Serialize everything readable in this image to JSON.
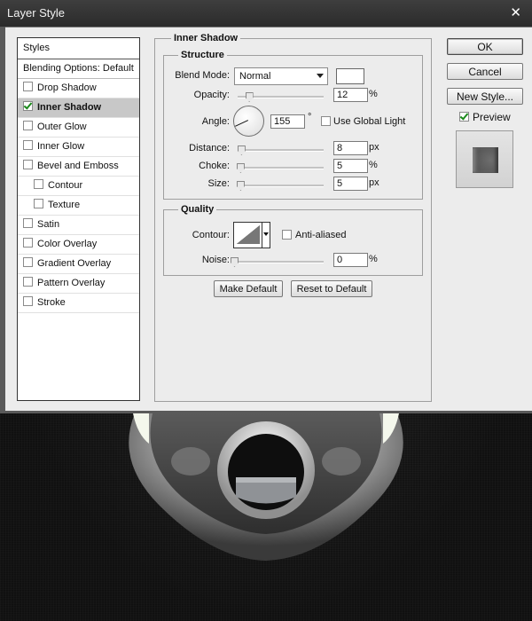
{
  "dialog": {
    "title": "Layer Style",
    "close_label": "✕"
  },
  "style_list": {
    "header": "Styles",
    "blending": "Blending Options: Default",
    "items": [
      {
        "label": "Drop Shadow",
        "checked": false,
        "sub": false,
        "active": false
      },
      {
        "label": "Inner Shadow",
        "checked": true,
        "sub": false,
        "active": true
      },
      {
        "label": "Outer Glow",
        "checked": false,
        "sub": false,
        "active": false
      },
      {
        "label": "Inner Glow",
        "checked": false,
        "sub": false,
        "active": false
      },
      {
        "label": "Bevel and Emboss",
        "checked": false,
        "sub": false,
        "active": false
      },
      {
        "label": "Contour",
        "checked": false,
        "sub": true,
        "active": false
      },
      {
        "label": "Texture",
        "checked": false,
        "sub": true,
        "active": false
      },
      {
        "label": "Satin",
        "checked": false,
        "sub": false,
        "active": false
      },
      {
        "label": "Color Overlay",
        "checked": false,
        "sub": false,
        "active": false
      },
      {
        "label": "Gradient Overlay",
        "checked": false,
        "sub": false,
        "active": false
      },
      {
        "label": "Pattern Overlay",
        "checked": false,
        "sub": false,
        "active": false
      },
      {
        "label": "Stroke",
        "checked": false,
        "sub": false,
        "active": false
      }
    ]
  },
  "inner_shadow": {
    "title": "Inner Shadow",
    "structure": {
      "title": "Structure",
      "blend_mode_label": "Blend Mode:",
      "blend_mode_value": "Normal",
      "blend_color": "#ffffff",
      "opacity_label": "Opacity:",
      "opacity_value": "12",
      "opacity_unit": "%",
      "angle_label": "Angle:",
      "angle_value": "155",
      "angle_unit": "°",
      "use_global_light_label": "Use Global Light",
      "use_global_light": false,
      "distance_label": "Distance:",
      "distance_value": "8",
      "distance_unit": "px",
      "choke_label": "Choke:",
      "choke_value": "5",
      "choke_unit": "%",
      "size_label": "Size:",
      "size_value": "5",
      "size_unit": "px"
    },
    "quality": {
      "title": "Quality",
      "contour_label": "Contour:",
      "anti_aliased_label": "Anti-aliased",
      "anti_aliased": false,
      "noise_label": "Noise:",
      "noise_value": "0",
      "noise_unit": "%"
    },
    "make_default_label": "Make Default",
    "reset_default_label": "Reset to Default"
  },
  "actions": {
    "ok_label": "OK",
    "cancel_label": "Cancel",
    "new_style_label": "New Style...",
    "preview_label": "Preview",
    "preview_checked": true
  }
}
